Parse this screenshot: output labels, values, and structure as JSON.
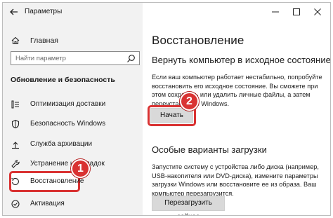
{
  "window": {
    "title": "Параметры"
  },
  "sidebar": {
    "home_label": "Главная",
    "search_placeholder": "Найти параметр",
    "section_title": "Обновление и безопасность",
    "items": [
      {
        "label": "Оптимизация доставки",
        "icon": "delivery-optimization-icon"
      },
      {
        "label": "Безопасность Windows",
        "icon": "shield-icon"
      },
      {
        "label": "Служба архивации",
        "icon": "backup-icon"
      },
      {
        "label": "Устранение неполадок",
        "icon": "wrench-icon"
      },
      {
        "label": "Восстановление",
        "icon": "recovery-icon"
      },
      {
        "label": "Активация",
        "icon": "activation-icon"
      }
    ]
  },
  "main": {
    "title": "Восстановление",
    "reset": {
      "heading": "Вернуть компьютер в исходное состояние",
      "description": "Если ваш компьютер работает нестабильно, попробуйте восстановить его исходное состояние. Вы сможете при этом сохранить или удалить личные файлы, а затем переустановить Windows.",
      "button": "Начать"
    },
    "advanced": {
      "heading": "Особые варианты загрузки",
      "description": "Запустите систему с устройства либо диска (например, USB-накопителя или DVD-диска), измените параметры загрузки Windows или восстановите ее из образа. Ваш компьютер перезагрузится.",
      "button": "Перезагрузить сейчас"
    }
  },
  "annotations": {
    "step1": "1",
    "step2": "2",
    "color": "#d93232"
  }
}
